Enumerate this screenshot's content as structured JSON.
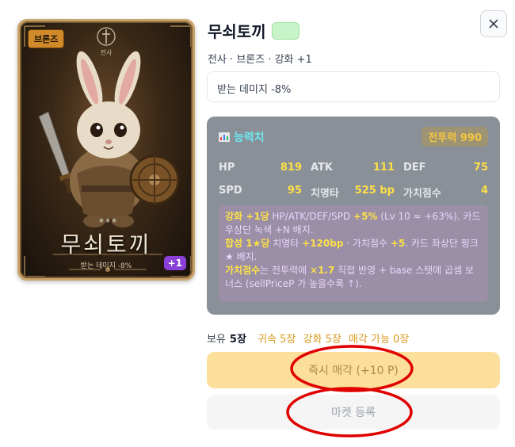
{
  "card": {
    "grade_badge": "브론즈",
    "emblem_text": "전사",
    "name": "무쇠토끼",
    "effect": "받는 데미지 -8%",
    "plus_badge": "+1",
    "stars": "★★★"
  },
  "header": {
    "title": "무쇠토끼",
    "title_badge": "",
    "subtitle": "전사 · 브론즈 · 강화 +1",
    "effect": "받는 데미지 -8%"
  },
  "stats": {
    "title": "능력치",
    "power_label": "전투력 990",
    "items": [
      {
        "key": "HP",
        "value": "819"
      },
      {
        "key": "ATK",
        "value": "111"
      },
      {
        "key": "DEF",
        "value": "75"
      },
      {
        "key": "SPD",
        "value": "95"
      },
      {
        "key": "치명타",
        "value": "525 bp"
      },
      {
        "key": "가치점수",
        "value": "4"
      }
    ],
    "notes": {
      "l1_y": "강화 +1당",
      "l1_a": " HP/ATK/DEF/SPD ",
      "l1_b": "+5%",
      "l1_c": " (Lv 10 ≈ +63%). 카드 우상단 녹색 +N 배지.",
      "l2_y": "합성 1★당",
      "l2_a": " 치명타 ",
      "l2_b": "+120bp",
      "l2_c": " · 가치점수 ",
      "l2_d": "+5",
      "l2_e": ". 카드 좌상단 핑크 ★ 배지.",
      "l3_y": "가치점수",
      "l3_a": "는 전투력에 ",
      "l3_b": "×1.7",
      "l3_c": " 직접 반영 + base 스탯에 곱셈 보너스 (sellPriceP 가 높을수록 ↑)."
    }
  },
  "holdings": {
    "owned_label": "보유",
    "owned_value": "5장",
    "bound": "귀속 5장",
    "enhanced": "강화 5장",
    "sellable": "매각 가능 0장"
  },
  "actions": {
    "sell_label": "즉시 매각 (+10 P)",
    "market_label": "마켓 등록"
  },
  "colors": {
    "accent_cyan": "#6ee7f0",
    "stat_value_yellow": "#fde047",
    "sell_button_bg": "#fbdf9b",
    "annotation_red": "#e00000",
    "plus_badge_purple": "#8b3fd9"
  },
  "icons": {
    "close": "close-icon",
    "stats": "bar-chart-icon"
  }
}
